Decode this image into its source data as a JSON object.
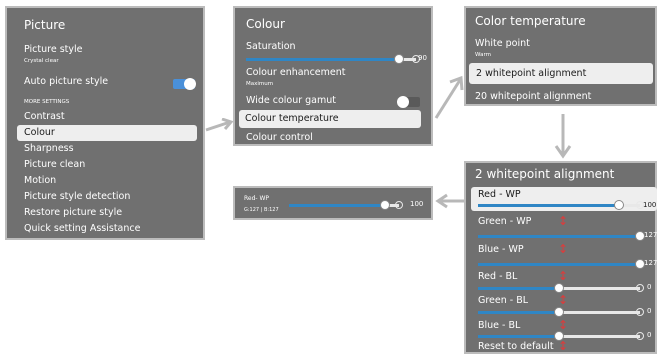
{
  "picture": {
    "title": "Picture",
    "items": {
      "picture_style": "Picture style",
      "picture_style_value": "Crystal clear",
      "auto_picture_style": "Auto picture style",
      "more_settings": "MORE SETTINGS",
      "contrast": "Contrast",
      "colour": "Colour",
      "sharpness": "Sharpness",
      "picture_clean": "Picture clean",
      "motion": "Motion",
      "picture_style_detection": "Picture style detection",
      "restore_picture_style": "Restore picture style",
      "quick_setting_assistance": "Quick setting Assistance"
    },
    "auto_picture_style_on": true
  },
  "colour": {
    "title": "Colour",
    "saturation_label": "Saturation",
    "saturation_value": "90",
    "saturation_level": 0.9,
    "colour_enhancement": "Colour enhancement",
    "colour_enhancement_value": "Maximum",
    "wide_colour_gamut": "Wide colour gamut",
    "wide_colour_gamut_on": false,
    "colour_temperature": "Colour temperature",
    "colour_control": "Colour control"
  },
  "colour_temp": {
    "title": "Color temperature",
    "white_point": "White point",
    "white_point_value": "Warm",
    "two_wp": "2 whitepoint alignment",
    "twenty_wp": "20 whitepoint alignment"
  },
  "two_wp": {
    "title": "2 whitepoint alignment",
    "sliders": [
      {
        "label": "Red - WP",
        "value": "100",
        "level": 0.87,
        "selected": true
      },
      {
        "label": "Green - WP",
        "value": "127",
        "level": 1.0
      },
      {
        "label": "Blue - WP",
        "value": "127",
        "level": 1.0
      },
      {
        "label": "Red - BL",
        "value": "0",
        "level": 0.5
      },
      {
        "label": "Green - BL",
        "value": "0",
        "level": 0.5
      },
      {
        "label": "Blue - BL",
        "value": "0",
        "level": 0.5
      }
    ],
    "reset": "Reset to default"
  },
  "popup": {
    "label": "Red- WP",
    "sub": "G:127 | B:127",
    "value": "100",
    "level": 0.87
  },
  "colors": {
    "panel_bg": "#707070",
    "panel_border": "#bcbcbc",
    "highlight": "#eeeeee",
    "accent_blue": "#2f86c5",
    "toggle_on": "#4a90d9",
    "arrow_red": "#e03a3a"
  }
}
